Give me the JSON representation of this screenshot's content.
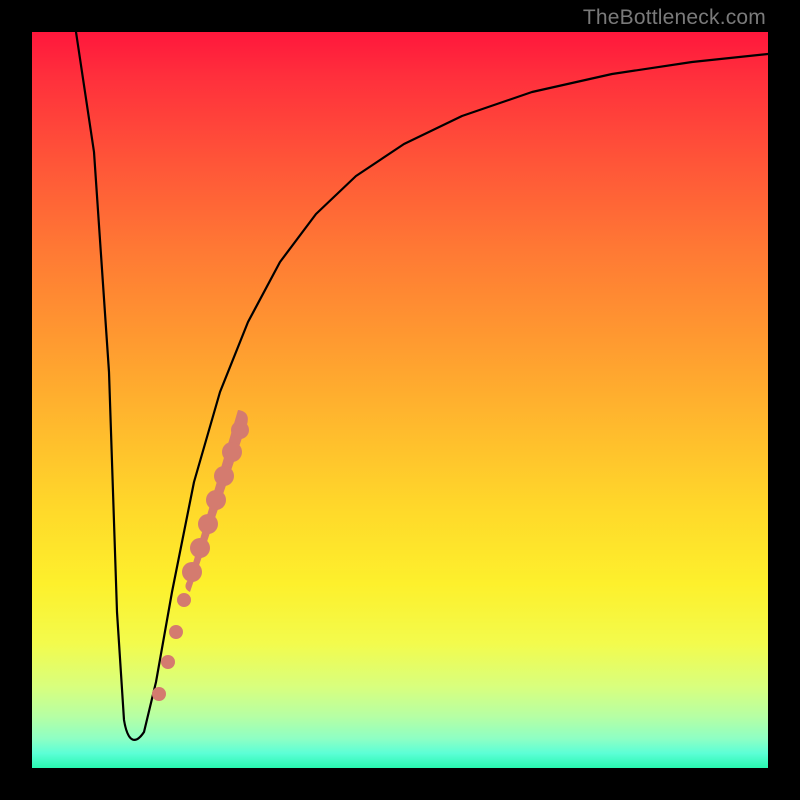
{
  "watermark": "TheBottleneck.com",
  "colors": {
    "frame": "#000000",
    "curve": "#000000",
    "marker": "#d47b6f"
  },
  "chart_data": {
    "type": "line",
    "title": "",
    "xlabel": "",
    "ylabel": "",
    "xlim": [
      0,
      100
    ],
    "ylim": [
      0,
      100
    ],
    "grid": false,
    "note": "Axes have no tick labels in the source image; values are normalized 0–100 in both directions. y is inverted in the SVG (0 at top).",
    "series": [
      {
        "name": "bottleneck-curve",
        "x": [
          6,
          8,
          10,
          11.5,
          12.5,
          14,
          16,
          18,
          21,
          24,
          27,
          30,
          33,
          36,
          40,
          45,
          50,
          56,
          62,
          70,
          80,
          90,
          100
        ],
        "y": [
          100,
          66,
          33,
          8,
          3,
          3,
          8,
          20,
          33,
          45,
          55,
          63,
          70,
          75,
          80,
          84.5,
          88,
          90.5,
          92.5,
          94.3,
          95.8,
          96.8,
          97.4
        ]
      }
    ],
    "markers": {
      "name": "highlighted-segment",
      "points": [
        {
          "x": 18.5,
          "y": 23,
          "r": 7
        },
        {
          "x": 20.0,
          "y": 27,
          "r": 7
        },
        {
          "x": 21.0,
          "y": 32,
          "r": 7
        },
        {
          "x": 22.0,
          "y": 36,
          "r": 8
        },
        {
          "x": 23.0,
          "y": 40,
          "r": 9
        },
        {
          "x": 24.0,
          "y": 44,
          "r": 10
        },
        {
          "x": 25.0,
          "y": 48,
          "r": 10
        },
        {
          "x": 26.0,
          "y": 52,
          "r": 10
        },
        {
          "x": 27.0,
          "y": 55,
          "r": 10
        },
        {
          "x": 28.0,
          "y": 58,
          "r": 10
        }
      ]
    }
  }
}
